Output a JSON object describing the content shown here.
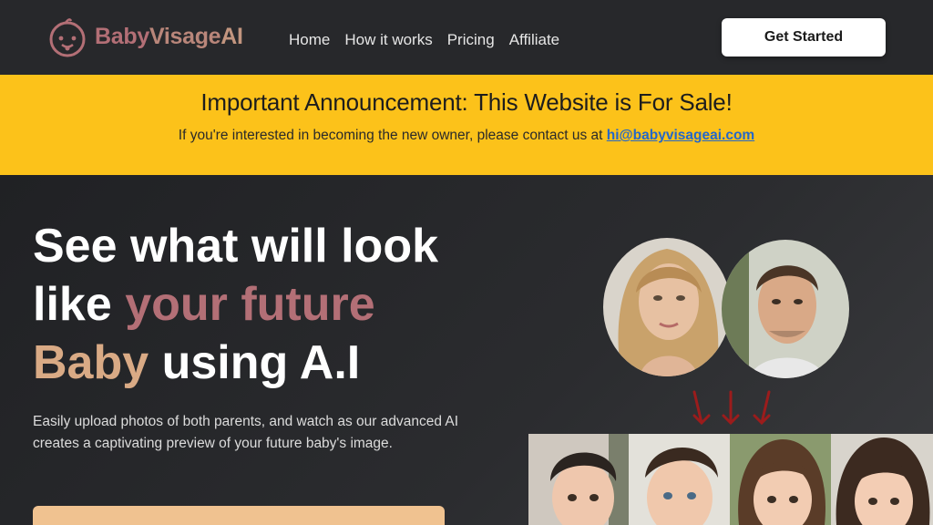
{
  "header": {
    "logo": {
      "part1": "Baby",
      "part2": "Visage",
      "part3": "AI",
      "icon": "baby-face-icon"
    },
    "nav": [
      {
        "label": "Home"
      },
      {
        "label": "How it works"
      },
      {
        "label": "Pricing"
      },
      {
        "label": "Affiliate"
      }
    ],
    "cta_label": "Get Started"
  },
  "announcement": {
    "title": "Important Announcement: This Website is For Sale!",
    "text": "If you're interested in becoming the new owner, please contact us at",
    "email": "hi@babyvisageai.com"
  },
  "hero": {
    "headline_1": "See what will look",
    "headline_2": "like ",
    "headline_highlight_1": "your future",
    "headline_highlight_2": "Baby",
    "headline_3": " using A.I",
    "subtitle": "Easily upload photos of both parents, and watch as our advanced AI creates a captivating preview of your future baby's image."
  },
  "colors": {
    "header_bg": "#27282b",
    "announcement_bg": "#fcc21a",
    "brand_pink": "#b36f76",
    "brand_tan": "#d9aa85",
    "link": "#2567c8",
    "arrow_red": "#9b1c1c"
  }
}
